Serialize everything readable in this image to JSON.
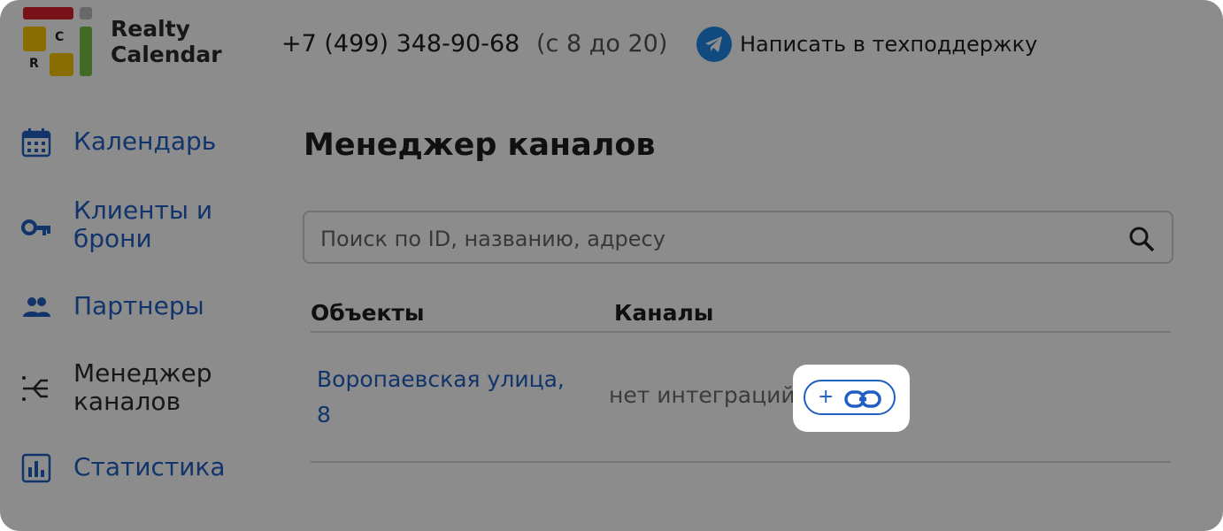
{
  "header": {
    "brand_line1": "Realty",
    "brand_line2": "Calendar",
    "logo_letter_c": "C",
    "logo_letter_r": "R",
    "phone": "+7 (499) 348-90-68",
    "hours": "(с 8 до 20)",
    "support_label": "Написать в техподдержку",
    "support_icon": "telegram-icon"
  },
  "sidebar": {
    "items": [
      {
        "label": "Календарь",
        "icon": "calendar-icon"
      },
      {
        "label_line1": "Клиенты и",
        "label_line2": "брони",
        "icon": "key-icon"
      },
      {
        "label": "Партнеры",
        "icon": "people-icon"
      },
      {
        "label_line1": "Менеджер",
        "label_line2": "каналов",
        "icon": "channels-icon"
      },
      {
        "label": "Статистика",
        "icon": "bar-chart-icon"
      }
    ]
  },
  "main": {
    "title": "Менеджер каналов",
    "search": {
      "placeholder": "Поиск по ID, названию, адресу",
      "value": ""
    },
    "table": {
      "columns": [
        "Объекты",
        "Каналы"
      ],
      "rows": [
        {
          "object_line1": "Воропаевская улица,",
          "object_line2": "8",
          "channels": "нет интеграций",
          "add_label": "+"
        }
      ]
    }
  },
  "colors": {
    "accent": "#1f5fc4",
    "logo_red": "#d9232d",
    "logo_yellow": "#f7c600",
    "logo_green": "#7ac143",
    "telegram": "#1e88e5"
  }
}
